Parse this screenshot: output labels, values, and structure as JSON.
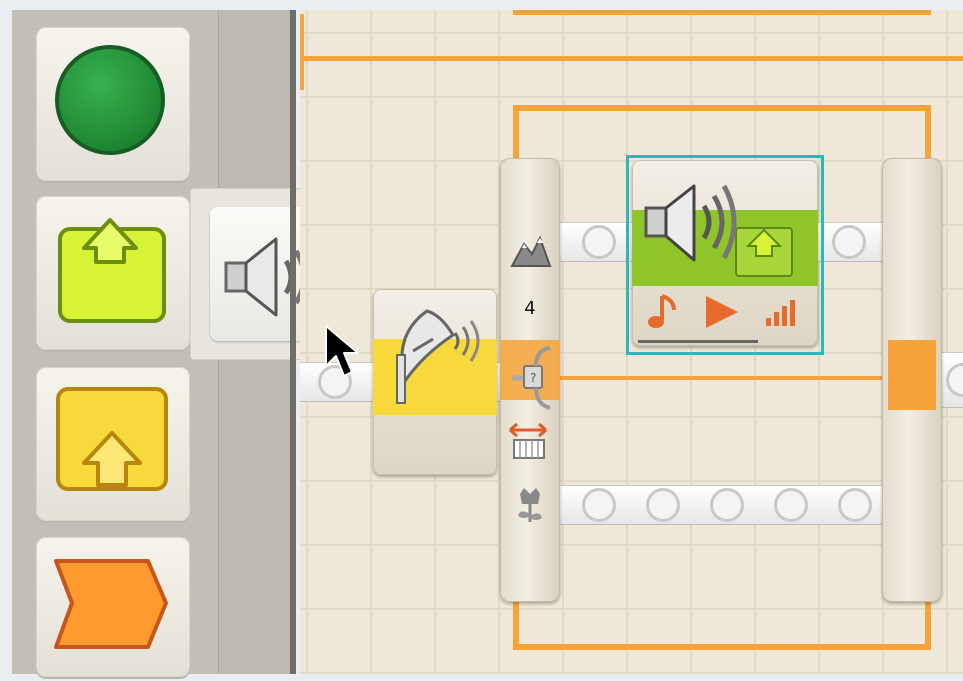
{
  "palette": {
    "items": [
      {
        "name": "start-block",
        "icon": "green-circle-icon",
        "color": "#1f9a3a"
      },
      {
        "name": "action-blocks",
        "icon": "lime-upload-box-icon",
        "color": "#d6f23a"
      },
      {
        "name": "sensor-blocks",
        "icon": "yellow-upload-box-icon",
        "color": "#f7d93c"
      },
      {
        "name": "flow-blocks",
        "icon": "orange-chevron-icon",
        "color": "#ff9a2e"
      }
    ],
    "flyout": {
      "icon": "speaker-icon"
    }
  },
  "canvas": {
    "switch_block": {
      "value_label": "4",
      "icons": [
        "mountains-icon",
        "branch-icon",
        "arrow-width-icon",
        "flower-icon"
      ]
    },
    "receive_message_block": {
      "icon": "satellite-dish-icon",
      "color": "#f7d93c"
    },
    "sound_block": {
      "icon": "speaker-icon",
      "footer_icons": [
        "note-icon",
        "play-icon",
        "volume-bars-icon"
      ],
      "selected": true,
      "color": "#8fc42a"
    }
  },
  "colors": {
    "accent_orange": "#f6a33a",
    "selection": "#2ab8b8"
  }
}
